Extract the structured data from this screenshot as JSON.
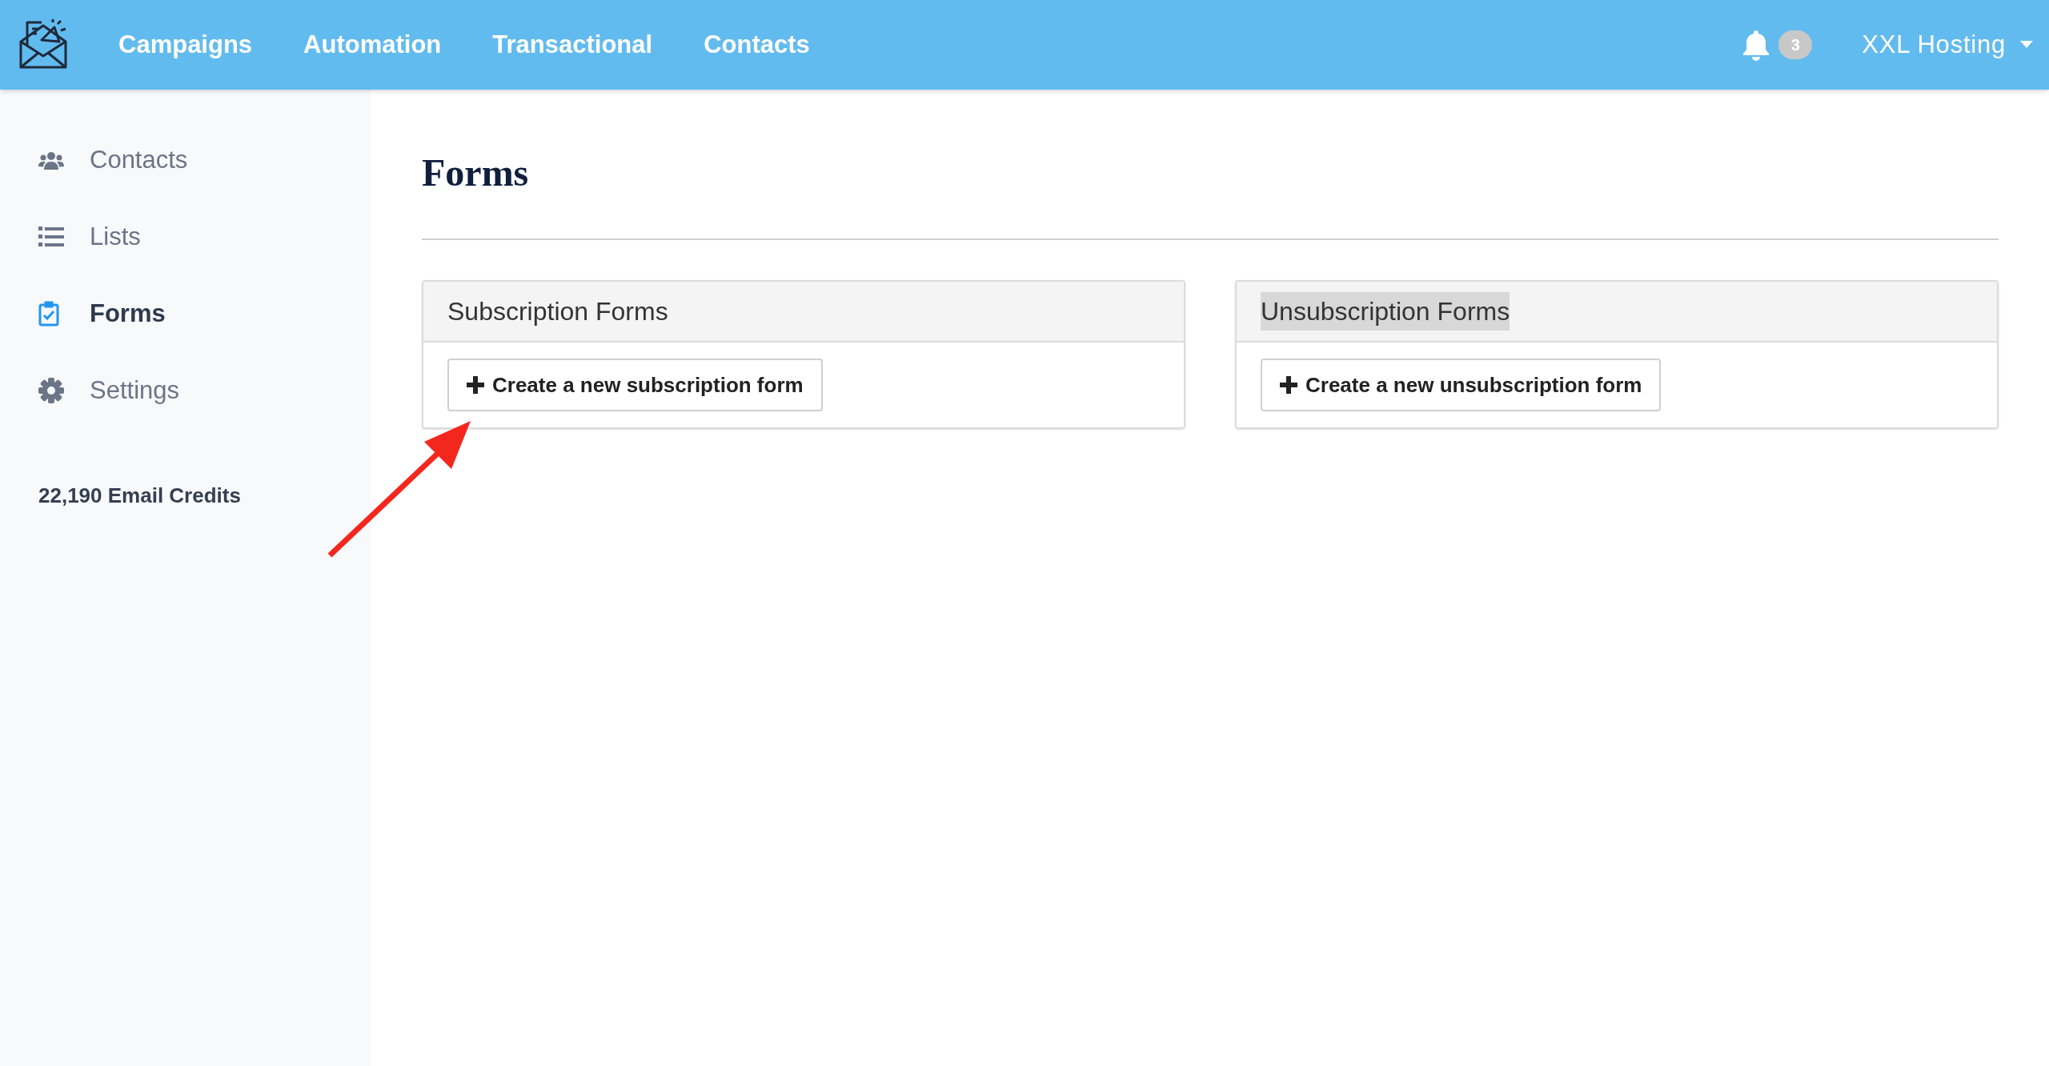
{
  "top_nav": {
    "items": [
      {
        "label": "Campaigns",
        "selected": false
      },
      {
        "label": "Automation",
        "selected": false
      },
      {
        "label": "Transactional",
        "selected": false
      },
      {
        "label": "Contacts",
        "selected": false
      }
    ],
    "notifications": {
      "count": "3"
    },
    "account": {
      "label": "XXL Hosting"
    }
  },
  "sidebar": {
    "items": [
      {
        "label": "Contacts",
        "selected": false
      },
      {
        "label": "Lists",
        "selected": false
      },
      {
        "label": "Forms",
        "selected": true
      },
      {
        "label": "Settings",
        "selected": false
      }
    ],
    "credits": "22,190 Email Credits"
  },
  "page": {
    "title": "Forms",
    "cards": [
      {
        "title": "Subscription Forms",
        "highlighted": false,
        "button": "Create a new subscription form"
      },
      {
        "title": "Unsubscription Forms",
        "highlighted": true,
        "button": "Create a new unsubscription form"
      }
    ]
  }
}
